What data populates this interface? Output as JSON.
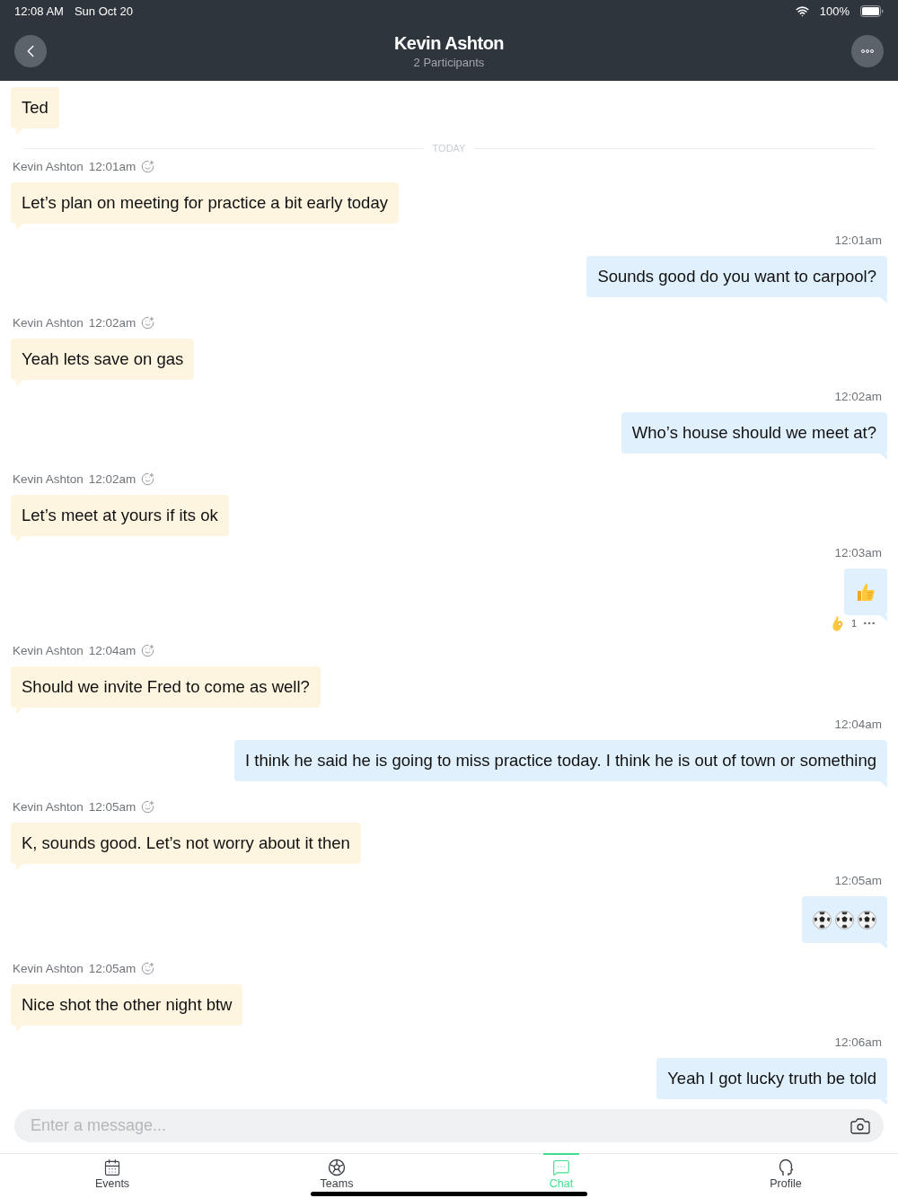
{
  "status_bar": {
    "time": "12:08 AM",
    "date": "Sun Oct 20",
    "battery": "100%"
  },
  "header": {
    "title": "Kevin Ashton",
    "subtitle": "2 Participants"
  },
  "messages": [
    {
      "kind": "incoming",
      "text": "Ted"
    },
    {
      "kind": "divider",
      "text": "TODAY"
    },
    {
      "kind": "incoming",
      "sender": "Kevin Ashton",
      "time": "12:01am",
      "text": "Let’s plan on meeting for practice a bit early today"
    },
    {
      "kind": "outgoing",
      "time": "12:01am",
      "text": "Sounds good do you want to carpool?"
    },
    {
      "kind": "incoming",
      "sender": "Kevin Ashton",
      "time": "12:02am",
      "text": "Yeah lets save on gas"
    },
    {
      "kind": "outgoing",
      "time": "12:02am",
      "text": "Who’s house should we meet at?"
    },
    {
      "kind": "incoming",
      "sender": "Kevin Ashton",
      "time": "12:02am",
      "text": "Let’s meet at yours if its ok"
    },
    {
      "kind": "outgoing",
      "time": "12:03am",
      "stickers": [
        {
          "kind": "thumbs"
        }
      ],
      "reaction": {
        "count": "1"
      }
    },
    {
      "kind": "incoming",
      "sender": "Kevin Ashton",
      "time": "12:04am",
      "text": "Should we invite Fred to come as well?"
    },
    {
      "kind": "outgoing",
      "time": "12:04am",
      "text": "I think he said he is going to miss practice today. I think he is out of town or something"
    },
    {
      "kind": "incoming",
      "sender": "Kevin Ashton",
      "time": "12:05am",
      "text": "K, sounds good. Let’s not worry about it then"
    },
    {
      "kind": "outgoing",
      "time": "12:05am",
      "stickers": [
        {
          "kind": "ball"
        },
        {
          "kind": "ball"
        },
        {
          "kind": "ball"
        }
      ]
    },
    {
      "kind": "incoming",
      "sender": "Kevin Ashton",
      "time": "12:05am",
      "text": "Nice shot the other night btw"
    },
    {
      "kind": "outgoing",
      "time": "12:06am",
      "text": "Yeah I got lucky truth be told"
    }
  ],
  "composer": {
    "placeholder": "Enter a message..."
  },
  "tabs": [
    {
      "label": "Events",
      "selected": false
    },
    {
      "label": "Teams",
      "selected": false
    },
    {
      "label": "Chat",
      "selected": true
    },
    {
      "label": "Profile",
      "selected": false
    }
  ]
}
